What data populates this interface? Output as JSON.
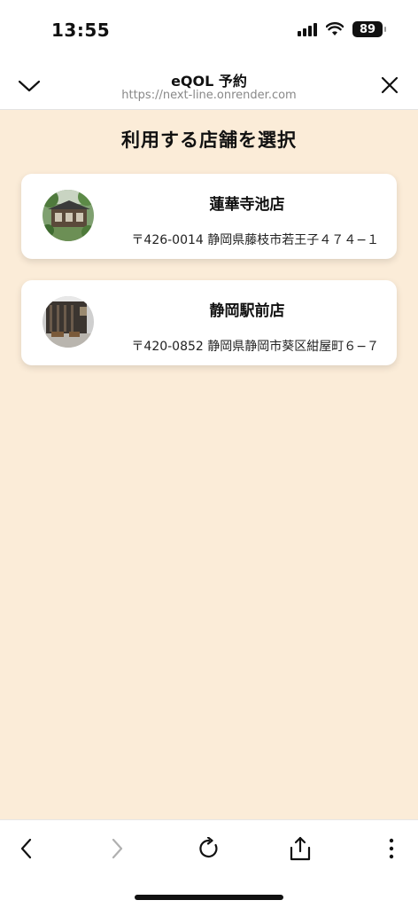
{
  "status": {
    "time": "13:55",
    "battery": "89"
  },
  "browser": {
    "title": "eQOL 予約",
    "url": "https://next-line.onrender.com"
  },
  "page": {
    "title": "利用する店舗を選択"
  },
  "stores": [
    {
      "name": "蓮華寺池店",
      "address": "〒426-0014 静岡県藤枝市若王子４７４−１"
    },
    {
      "name": "静岡駅前店",
      "address": "〒420-0852 静岡県静岡市葵区紺屋町６−７"
    }
  ],
  "colors": {
    "background": "#fbecd8",
    "card": "#ffffff",
    "text": "#111111",
    "disabled": "#b0b0b0"
  },
  "icons": {
    "header_left": "chevron-down-icon",
    "header_right": "close-icon",
    "toolbar": [
      "back-icon",
      "forward-icon",
      "reload-icon",
      "share-icon",
      "more-icon"
    ]
  }
}
